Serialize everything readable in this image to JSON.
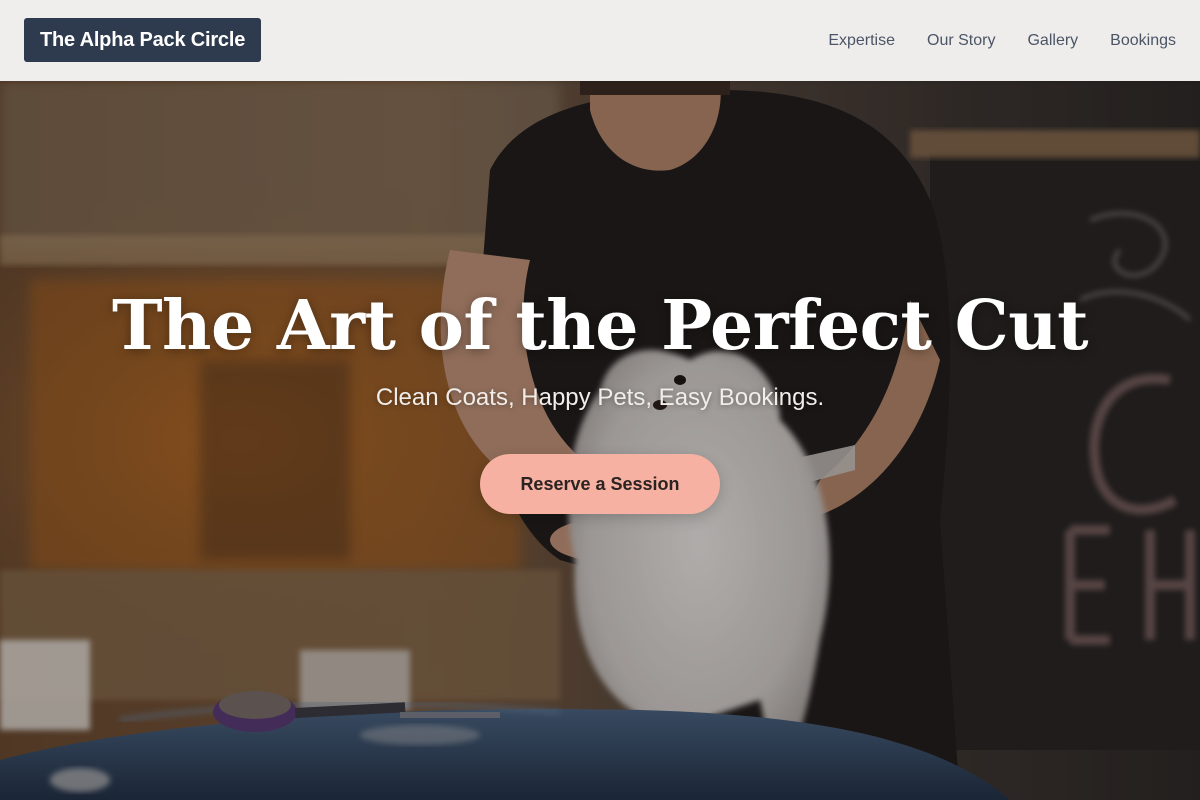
{
  "header": {
    "brand": "The Alpha Pack Circle",
    "nav": [
      {
        "label": "Expertise"
      },
      {
        "label": "Our Story"
      },
      {
        "label": "Gallery"
      },
      {
        "label": "Bookings"
      }
    ]
  },
  "hero": {
    "title": "The Art of the Perfect Cut",
    "subtitle": "Clean Coats, Happy Pets, Easy Bookings.",
    "cta_label": "Reserve a Session",
    "image_subject": "groomer combing a small white dog on a grooming table"
  },
  "colors": {
    "brand_bg": "#2e3a4d",
    "header_bg": "#f7f6f5",
    "nav_text": "#4b5565",
    "cta_bg": "#f7b1a2",
    "cta_text": "#2b2321"
  }
}
